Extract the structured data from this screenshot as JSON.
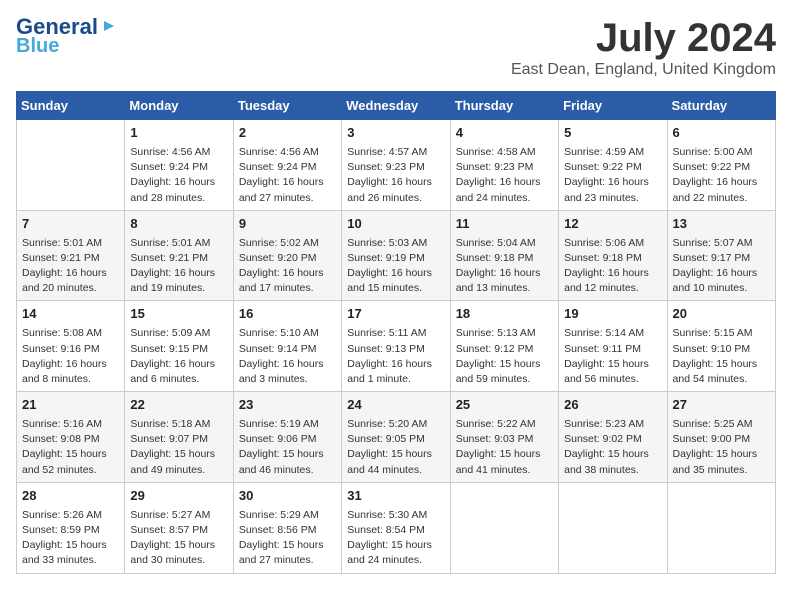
{
  "logo": {
    "general": "General",
    "blue": "Blue"
  },
  "title": "July 2024",
  "subtitle": "East Dean, England, United Kingdom",
  "days_header": [
    "Sunday",
    "Monday",
    "Tuesday",
    "Wednesday",
    "Thursday",
    "Friday",
    "Saturday"
  ],
  "weeks": [
    [
      {
        "day": "",
        "content": ""
      },
      {
        "day": "1",
        "content": "Sunrise: 4:56 AM\nSunset: 9:24 PM\nDaylight: 16 hours\nand 28 minutes."
      },
      {
        "day": "2",
        "content": "Sunrise: 4:56 AM\nSunset: 9:24 PM\nDaylight: 16 hours\nand 27 minutes."
      },
      {
        "day": "3",
        "content": "Sunrise: 4:57 AM\nSunset: 9:23 PM\nDaylight: 16 hours\nand 26 minutes."
      },
      {
        "day": "4",
        "content": "Sunrise: 4:58 AM\nSunset: 9:23 PM\nDaylight: 16 hours\nand 24 minutes."
      },
      {
        "day": "5",
        "content": "Sunrise: 4:59 AM\nSunset: 9:22 PM\nDaylight: 16 hours\nand 23 minutes."
      },
      {
        "day": "6",
        "content": "Sunrise: 5:00 AM\nSunset: 9:22 PM\nDaylight: 16 hours\nand 22 minutes."
      }
    ],
    [
      {
        "day": "7",
        "content": "Sunrise: 5:01 AM\nSunset: 9:21 PM\nDaylight: 16 hours\nand 20 minutes."
      },
      {
        "day": "8",
        "content": "Sunrise: 5:01 AM\nSunset: 9:21 PM\nDaylight: 16 hours\nand 19 minutes."
      },
      {
        "day": "9",
        "content": "Sunrise: 5:02 AM\nSunset: 9:20 PM\nDaylight: 16 hours\nand 17 minutes."
      },
      {
        "day": "10",
        "content": "Sunrise: 5:03 AM\nSunset: 9:19 PM\nDaylight: 16 hours\nand 15 minutes."
      },
      {
        "day": "11",
        "content": "Sunrise: 5:04 AM\nSunset: 9:18 PM\nDaylight: 16 hours\nand 13 minutes."
      },
      {
        "day": "12",
        "content": "Sunrise: 5:06 AM\nSunset: 9:18 PM\nDaylight: 16 hours\nand 12 minutes."
      },
      {
        "day": "13",
        "content": "Sunrise: 5:07 AM\nSunset: 9:17 PM\nDaylight: 16 hours\nand 10 minutes."
      }
    ],
    [
      {
        "day": "14",
        "content": "Sunrise: 5:08 AM\nSunset: 9:16 PM\nDaylight: 16 hours\nand 8 minutes."
      },
      {
        "day": "15",
        "content": "Sunrise: 5:09 AM\nSunset: 9:15 PM\nDaylight: 16 hours\nand 6 minutes."
      },
      {
        "day": "16",
        "content": "Sunrise: 5:10 AM\nSunset: 9:14 PM\nDaylight: 16 hours\nand 3 minutes."
      },
      {
        "day": "17",
        "content": "Sunrise: 5:11 AM\nSunset: 9:13 PM\nDaylight: 16 hours\nand 1 minute."
      },
      {
        "day": "18",
        "content": "Sunrise: 5:13 AM\nSunset: 9:12 PM\nDaylight: 15 hours\nand 59 minutes."
      },
      {
        "day": "19",
        "content": "Sunrise: 5:14 AM\nSunset: 9:11 PM\nDaylight: 15 hours\nand 56 minutes."
      },
      {
        "day": "20",
        "content": "Sunrise: 5:15 AM\nSunset: 9:10 PM\nDaylight: 15 hours\nand 54 minutes."
      }
    ],
    [
      {
        "day": "21",
        "content": "Sunrise: 5:16 AM\nSunset: 9:08 PM\nDaylight: 15 hours\nand 52 minutes."
      },
      {
        "day": "22",
        "content": "Sunrise: 5:18 AM\nSunset: 9:07 PM\nDaylight: 15 hours\nand 49 minutes."
      },
      {
        "day": "23",
        "content": "Sunrise: 5:19 AM\nSunset: 9:06 PM\nDaylight: 15 hours\nand 46 minutes."
      },
      {
        "day": "24",
        "content": "Sunrise: 5:20 AM\nSunset: 9:05 PM\nDaylight: 15 hours\nand 44 minutes."
      },
      {
        "day": "25",
        "content": "Sunrise: 5:22 AM\nSunset: 9:03 PM\nDaylight: 15 hours\nand 41 minutes."
      },
      {
        "day": "26",
        "content": "Sunrise: 5:23 AM\nSunset: 9:02 PM\nDaylight: 15 hours\nand 38 minutes."
      },
      {
        "day": "27",
        "content": "Sunrise: 5:25 AM\nSunset: 9:00 PM\nDaylight: 15 hours\nand 35 minutes."
      }
    ],
    [
      {
        "day": "28",
        "content": "Sunrise: 5:26 AM\nSunset: 8:59 PM\nDaylight: 15 hours\nand 33 minutes."
      },
      {
        "day": "29",
        "content": "Sunrise: 5:27 AM\nSunset: 8:57 PM\nDaylight: 15 hours\nand 30 minutes."
      },
      {
        "day": "30",
        "content": "Sunrise: 5:29 AM\nSunset: 8:56 PM\nDaylight: 15 hours\nand 27 minutes."
      },
      {
        "day": "31",
        "content": "Sunrise: 5:30 AM\nSunset: 8:54 PM\nDaylight: 15 hours\nand 24 minutes."
      },
      {
        "day": "",
        "content": ""
      },
      {
        "day": "",
        "content": ""
      },
      {
        "day": "",
        "content": ""
      }
    ]
  ]
}
